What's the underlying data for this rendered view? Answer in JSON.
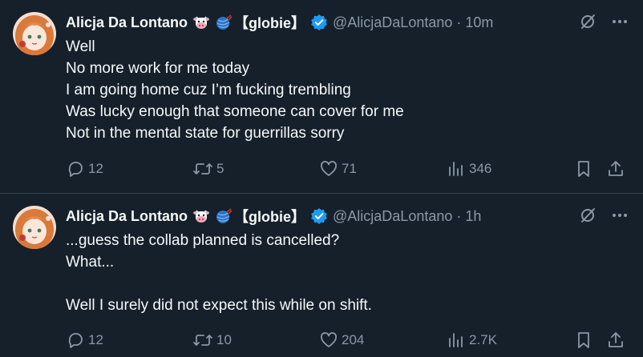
{
  "colors": {
    "background": "#15202b",
    "text": "#f7f9f9",
    "muted": "#8b98a5",
    "divider": "#38444d",
    "verified": "#1d9bf0"
  },
  "posts": [
    {
      "author": {
        "display_name": "Alicja Da Lontano",
        "emojis": [
          "cow-face-emoji",
          "yarn-ball-emoji"
        ],
        "name_suffix": "【globie】",
        "verified": true,
        "handle": "@AlicjaDaLontano"
      },
      "separator": "·",
      "time": "10m",
      "lines": [
        "Well",
        "No more work for me today",
        "I am going home cuz I’m fucking trembling",
        "Was lucky enough that someone can cover for me",
        "Not in the mental state for guerrillas sorry"
      ],
      "stats": {
        "replies": "12",
        "reposts": "5",
        "likes": "71",
        "views": "346"
      }
    },
    {
      "author": {
        "display_name": "Alicja Da Lontano",
        "emojis": [
          "cow-face-emoji",
          "yarn-ball-emoji"
        ],
        "name_suffix": "【globie】",
        "verified": true,
        "handle": "@AlicjaDaLontano"
      },
      "separator": "·",
      "time": "1h",
      "lines": [
        "...guess the collab planned is cancelled?",
        "What...",
        "",
        "Well I surely did not expect this while on shift."
      ],
      "stats": {
        "replies": "12",
        "reposts": "10",
        "likes": "204",
        "views": "2.7K"
      }
    }
  ],
  "icons": {
    "more": "more-icon",
    "grok": "grok-icon",
    "reply": "reply-icon",
    "repost": "repost-icon",
    "like": "like-icon",
    "views": "views-icon",
    "bookmark": "bookmark-icon",
    "share": "share-icon"
  }
}
